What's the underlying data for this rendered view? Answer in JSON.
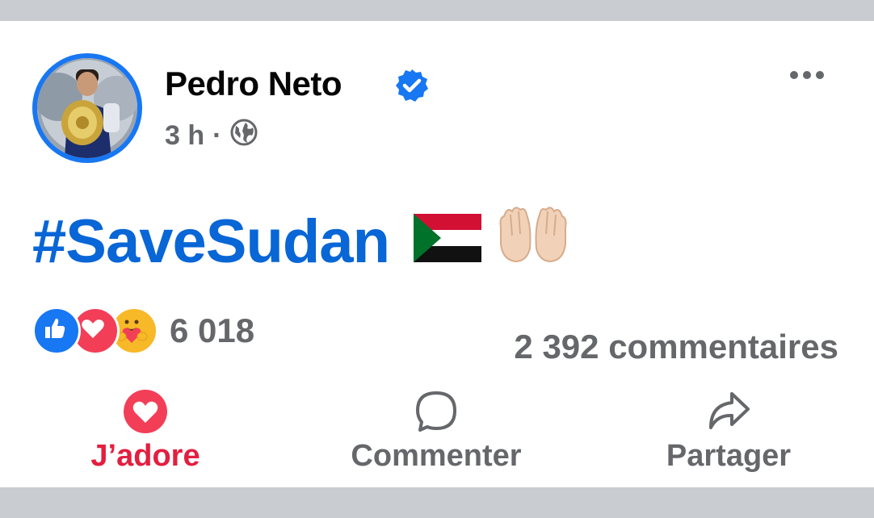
{
  "post": {
    "author": "Pedro Neto",
    "verified": true,
    "time": "3 h",
    "separator": "·",
    "audience_icon": "globe-icon",
    "text": "#SaveSudan",
    "emojis": [
      "sudan-flag",
      "palms-up-together"
    ],
    "reactions": {
      "types": [
        "like",
        "love",
        "care"
      ],
      "count": "6 018"
    },
    "comments_count": "2 392 commentaires"
  },
  "actions": {
    "love_label": "J’adore",
    "comment_label": "Commenter",
    "share_label": "Partager"
  },
  "colors": {
    "accent": "#1877f2",
    "hashtag": "#0866d6",
    "love": "#e41e3f",
    "muted": "#65676b"
  }
}
